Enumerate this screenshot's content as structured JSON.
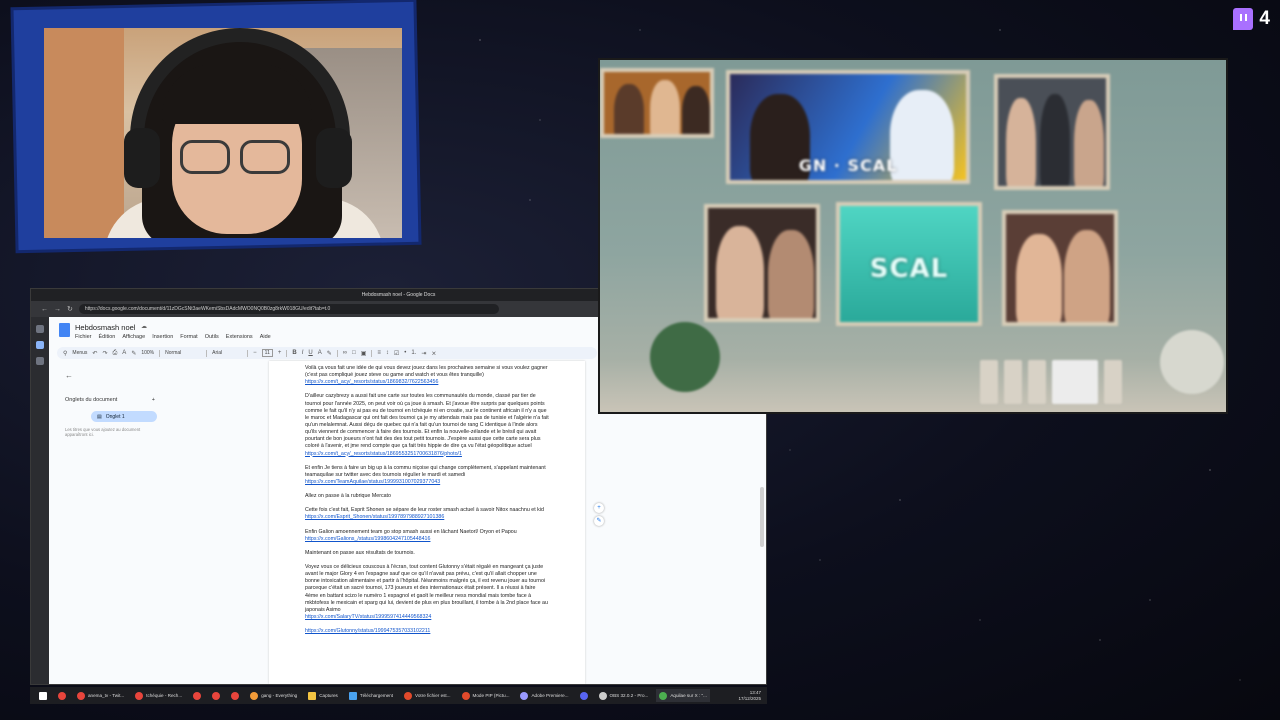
{
  "viewers": {
    "count": "4",
    "icon": "twitch-icon"
  },
  "browser": {
    "window_title": "Hebdosmash noel - Google Docs",
    "url": "https://docs.google.com/document/d/11zDGcSNt3aeWKemiSbsDAdcMWO0NQ0B0zg8rkW018GU/edit?tab=t.0"
  },
  "docs": {
    "title": "Hebdosmash noel",
    "menus": [
      "Fichier",
      "Édition",
      "Affichage",
      "Insertion",
      "Format",
      "Outils",
      "Extensions",
      "Aide"
    ],
    "toolbar": {
      "search": "Menus",
      "zoom": "100%",
      "style": "Normal",
      "font": "Arial",
      "size": "11"
    },
    "sidebar": {
      "tabs_heading": "Onglets du document",
      "add": "+",
      "tab_label": "Onglet 1",
      "hint": "Les titres que vous ajoutez au document apparaîtront ici."
    },
    "body": [
      {
        "text": "Voilà ça vous fait une idée de qui vous devez jouez dans les prochaines semaine si vous voulez gagner (c'est pas compliqué jouez steve ou game and watch et vous êtes tranquille)",
        "link": "https://x.com/t_acy/_resorts/status/1869832/7622563456"
      },
      {
        "text": "D'ailleur cazybrezy a aussi fait une carte sur toutes les communautés du monde, classé par tier de tournoi pour l'année 2025, on peut voir où ça joue à smash. Et j'avoue être surpris par quelques points comme le fait qu'il n'y ai pas eu de tournoi en tchéquie ni en croatie, sur le continent africain il n'y a que le maroc et Madagascar qui ont fait des tournoi ça je my attendais mais pas de tunisie et l'algérie n'a fait qu'un melalemnat. Aussi déçu de quebec qui n'a fait qu'un tournoi de rang C identique à l'inde alors qu'ils viennent de commencer à faire des tournois. Et enfin la nouvelle-zélande et le brésil qui avait pourtant de bon joueurs n'ont fait des des tout petit tournois. J'espère aussi que cette carte sera plus coloré à l'avenir, et jme rend compte que ça fait très hippie de dire ça vu l'état géopolitique actuel",
        "link": "https://x.com/t_acy/_resorts/status/1869553251700631876/photo/1"
      },
      {
        "text": "Et enfin Je tiens à faire un big up à la commu niçoise qui change complètement, s'appelant maintenant teamaquilae sur twitter avec des tournois régulier le mardi et samedi",
        "link": "https://x.com/TeamAquilae/status/1999931007029377043"
      },
      {
        "text": "Allez on passe à la rubrique Mercato",
        "link": ""
      },
      {
        "text": "Cette fois c'est fait, Esprit Shonen se sépare de leur roster smash actuel à savoir Nitox naachnu et kid",
        "link": "https://x.com/Esprit_Shonen/status/1997897988927101386"
      },
      {
        "text": "Enfin Galion amoennement team go stop smash aussi en lâchant Naetorl/ Oryon et Papou",
        "link": "https://x.com/Galions_/status/1998604247105448416"
      },
      {
        "text": "Maintenant on passe aux résultats de tournois.",
        "link": ""
      },
      {
        "text": "Voyez vous ce délicieux couscous à l'écran, tout content Glutonny s'était régalé en mangeant ça juste avant le major Glory 4 en l'espagne sauf que ce qu'il n'avait pas prévu, c'est qu'il allait chopper une bonne intoxication alimentaire et partir à l'hôpital. Néanmoins malgrés ça, il est revenu jouer au tournoi parceque c'était un sacré tournoi, 173 joueurs et des internationaux était présent. Il a réussi à faire 4ème en battant scizo le numéro 1 espagnol et gaolt le meilleur ness mondial mais tombe face à mkbtofess le mexicain et sparg qui lui, devient de plus en plus brouillant, il tombe à la 2nd place face au japonais Asimo",
        "link": "https://x.com/SalaryTV/status/1999597414449568324"
      },
      {
        "text": "",
        "link": "https://x.com/Glutonny/status/1999475357033102211"
      }
    ]
  },
  "taskbar": {
    "items": [
      {
        "label": "",
        "icon": "windows-icon",
        "color": "#ffffff"
      },
      {
        "label": "",
        "icon": "chrome-icon",
        "color": "#e8453c"
      },
      {
        "label": "anema_tv - Twit...",
        "icon": "chrome-icon",
        "color": "#e8453c"
      },
      {
        "label": "tchéquie - Rech...",
        "icon": "chrome-icon",
        "color": "#e8453c"
      },
      {
        "label": "",
        "icon": "chrome-icon",
        "color": "#e8453c"
      },
      {
        "label": "",
        "icon": "chrome-icon",
        "color": "#e8453c"
      },
      {
        "label": "",
        "icon": "chrome-icon",
        "color": "#e8453c"
      },
      {
        "label": "gang - Everything",
        "icon": "search-icon",
        "color": "#f29b38"
      },
      {
        "label": "Captures",
        "icon": "folder-icon",
        "color": "#f4c542"
      },
      {
        "label": "Téléchargement",
        "icon": "folder-icon",
        "color": "#4aa3f0"
      },
      {
        "label": "Votre fichier est...",
        "icon": "pdf-icon",
        "color": "#e24a2b"
      },
      {
        "label": "Mode PIP (Pictu...",
        "icon": "pdf-icon",
        "color": "#e24a2b"
      },
      {
        "label": "Adobe Premiere...",
        "icon": "premiere-icon",
        "color": "#9999ff"
      },
      {
        "label": "",
        "icon": "discord-icon",
        "color": "#5865f2"
      },
      {
        "label": "OBS 32.0.2 - Pro...",
        "icon": "obs-icon",
        "color": "#cccccc"
      },
      {
        "label": "Aquilae sur X : \"...",
        "icon": "chrome-icon",
        "color": "#4caf50"
      }
    ],
    "time": "13:47",
    "date": "17/12/2025"
  }
}
